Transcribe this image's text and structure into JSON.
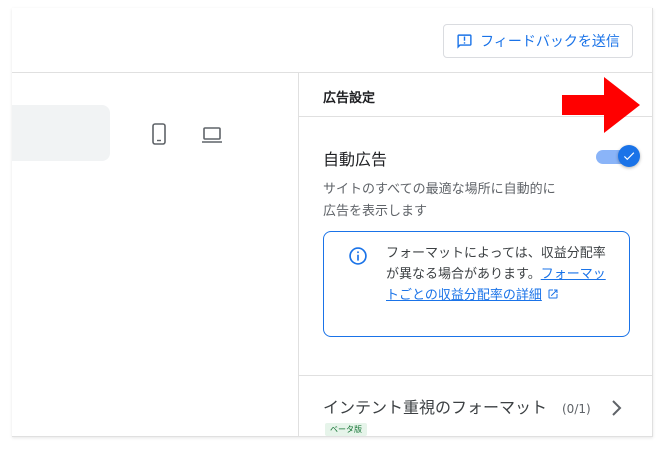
{
  "header": {
    "feedback_label": "フィードバックを送信",
    "feedback_icon": "feedback-icon"
  },
  "preview": {
    "devices": [
      "mobile-icon",
      "laptop-icon"
    ]
  },
  "panel": {
    "title": "広告設定",
    "auto_ads": {
      "label": "自動広告",
      "enabled": true,
      "description": "サイトのすべての最適な場所に自動的に広告を表示します"
    },
    "info": {
      "text": "フォーマットによっては、収益分配率が異なる場合があります。",
      "link": "フォーマットごとの収益分配率の詳細"
    },
    "intent_formats": {
      "label": "インテント重視のフォーマット",
      "badge": "ベータ版",
      "count": "(0/1)"
    }
  },
  "colors": {
    "accent": "#1a73e8",
    "annotation_arrow": "#ff0000",
    "beta_bg": "#e6f4ea",
    "beta_text": "#137333"
  }
}
